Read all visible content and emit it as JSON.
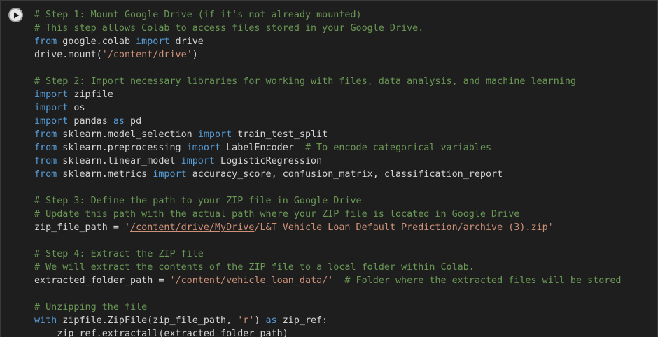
{
  "cell": {
    "run_icon": "play-icon",
    "colors": {
      "background": "#1e1e1e",
      "comment": "#6a9955",
      "keyword": "#569cd6",
      "string": "#ce9178",
      "text": "#d4d4d4"
    }
  },
  "code_lines": [
    [
      {
        "t": "c",
        "v": "# Step 1: Mount Google Drive (if it's not already mounted)"
      }
    ],
    [
      {
        "t": "c",
        "v": "# This step allows Colab to access files stored in your Google Drive."
      }
    ],
    [
      {
        "t": "k",
        "v": "from"
      },
      {
        "t": "t",
        "v": " google.colab "
      },
      {
        "t": "k",
        "v": "import"
      },
      {
        "t": "t",
        "v": " drive"
      }
    ],
    [
      {
        "t": "t",
        "v": "drive.mount("
      },
      {
        "t": "s",
        "v": "'"
      },
      {
        "t": "su",
        "v": "/content/drive"
      },
      {
        "t": "s",
        "v": "'"
      },
      {
        "t": "t",
        "v": ")"
      }
    ],
    [],
    [
      {
        "t": "c",
        "v": "# Step 2: Import necessary libraries for working with files, data analysis, and machine learning"
      }
    ],
    [
      {
        "t": "k",
        "v": "import"
      },
      {
        "t": "t",
        "v": " zipfile"
      }
    ],
    [
      {
        "t": "k",
        "v": "import"
      },
      {
        "t": "t",
        "v": " os"
      }
    ],
    [
      {
        "t": "k",
        "v": "import"
      },
      {
        "t": "t",
        "v": " pandas "
      },
      {
        "t": "k",
        "v": "as"
      },
      {
        "t": "t",
        "v": " pd"
      }
    ],
    [
      {
        "t": "k",
        "v": "from"
      },
      {
        "t": "t",
        "v": " sklearn.model_selection "
      },
      {
        "t": "k",
        "v": "import"
      },
      {
        "t": "t",
        "v": " train_test_split"
      }
    ],
    [
      {
        "t": "k",
        "v": "from"
      },
      {
        "t": "t",
        "v": " sklearn.preprocessing "
      },
      {
        "t": "k",
        "v": "import"
      },
      {
        "t": "t",
        "v": " LabelEncoder  "
      },
      {
        "t": "c",
        "v": "# To encode categorical variables"
      }
    ],
    [
      {
        "t": "k",
        "v": "from"
      },
      {
        "t": "t",
        "v": " sklearn.linear_model "
      },
      {
        "t": "k",
        "v": "import"
      },
      {
        "t": "t",
        "v": " LogisticRegression"
      }
    ],
    [
      {
        "t": "k",
        "v": "from"
      },
      {
        "t": "t",
        "v": " sklearn.metrics "
      },
      {
        "t": "k",
        "v": "import"
      },
      {
        "t": "t",
        "v": " accuracy_score, confusion_matrix, classification_report"
      }
    ],
    [],
    [
      {
        "t": "c",
        "v": "# Step 3: Define the path to your ZIP file in Google Drive"
      }
    ],
    [
      {
        "t": "c",
        "v": "# Update this path with the actual path where your ZIP file is located in Google Drive"
      }
    ],
    [
      {
        "t": "t",
        "v": "zip_file_path = "
      },
      {
        "t": "s",
        "v": "'"
      },
      {
        "t": "su",
        "v": "/content/drive/MyDrive"
      },
      {
        "t": "s",
        "v": "/L&T Vehicle Loan Default Prediction/archive (3).zip'"
      }
    ],
    [],
    [
      {
        "t": "c",
        "v": "# Step 4: Extract the ZIP file"
      }
    ],
    [
      {
        "t": "c",
        "v": "# We will extract the contents of the ZIP file to a local folder within Colab."
      }
    ],
    [
      {
        "t": "t",
        "v": "extracted_folder_path = "
      },
      {
        "t": "s",
        "v": "'"
      },
      {
        "t": "su",
        "v": "/content/vehicle_loan_data/"
      },
      {
        "t": "s",
        "v": "'"
      },
      {
        "t": "t",
        "v": "  "
      },
      {
        "t": "c",
        "v": "# Folder where the extracted files will be stored"
      }
    ],
    [],
    [
      {
        "t": "c",
        "v": "# Unzipping the file"
      }
    ],
    [
      {
        "t": "k",
        "v": "with"
      },
      {
        "t": "t",
        "v": " zipfile.ZipFile(zip_file_path, "
      },
      {
        "t": "s",
        "v": "'r'"
      },
      {
        "t": "t",
        "v": ") "
      },
      {
        "t": "k",
        "v": "as"
      },
      {
        "t": "t",
        "v": " zip_ref:"
      }
    ],
    [
      {
        "t": "t",
        "v": "    zip_ref.extractall(extracted_folder_path)"
      }
    ]
  ]
}
